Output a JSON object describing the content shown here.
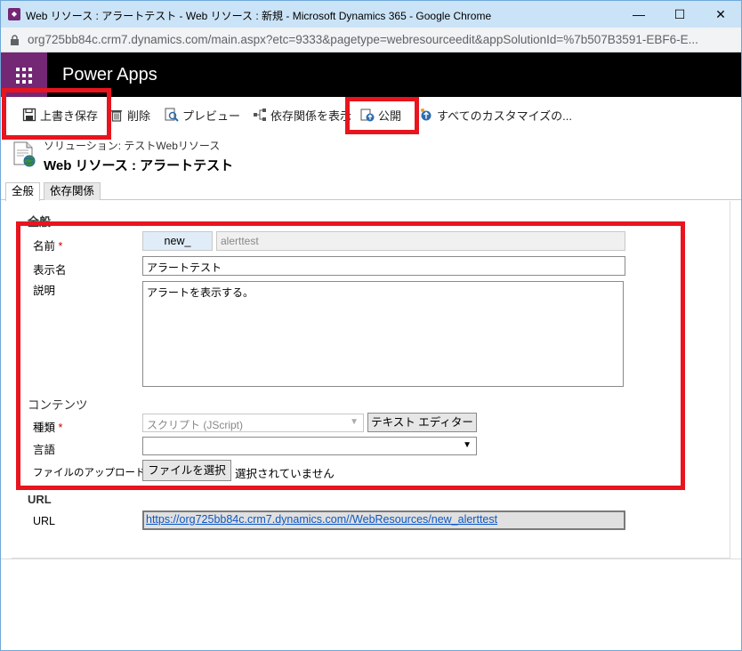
{
  "window": {
    "title": "Web リソース : アラートテスト - Web リソース : 新規 - Microsoft Dynamics 365 - Google Chrome",
    "minimize": "—",
    "maximize": "☐",
    "close": "✕"
  },
  "address": {
    "url": "org725bb84c.crm7.dynamics.com/main.aspx?etc=9333&pagetype=webresourceedit&appSolutionId=%7b507B3591-EBF6-E..."
  },
  "app": {
    "name": "Power Apps"
  },
  "toolbar": {
    "save_label": "上書き保存",
    "delete_label": "削除",
    "preview_label": "プレビュー",
    "dependencies_label": "依存関係を表示",
    "publish_label": "公開",
    "customize_label": "すべてのカスタマイズの..."
  },
  "header": {
    "solution": "ソリューション: テストWebリソース",
    "title": "Web リソース : アラートテスト"
  },
  "tabs": [
    {
      "label": "全般"
    },
    {
      "label": "依存関係"
    }
  ],
  "general": {
    "section_title": "全般",
    "name_label": "名前",
    "required_mark": "*",
    "name_prefix": "new_",
    "name_value": "alerttest",
    "display_name_label": "表示名",
    "display_name_value": "アラートテスト",
    "description_label": "説明",
    "description_value": "アラートを表示する。"
  },
  "contents": {
    "section_title": "コンテンツ",
    "type_label": "種類",
    "required_mark": "*",
    "type_value": "スクリプト (JScript)",
    "text_editor_button": "テキスト エディター",
    "language_label": "言語",
    "language_value": "",
    "upload_label": "ファイルのアップロード",
    "choose_file_button": "ファイルを選択",
    "no_file_text": "選択されていません"
  },
  "url_section": {
    "section_title": "URL",
    "url_label": "URL",
    "url_value": "https://org725bb84c.crm7.dynamics.com//WebResources/new_alerttest"
  },
  "colors": {
    "highlight": "#e8141e",
    "brand": "#742774",
    "titlebar": "#cbe3f7"
  }
}
